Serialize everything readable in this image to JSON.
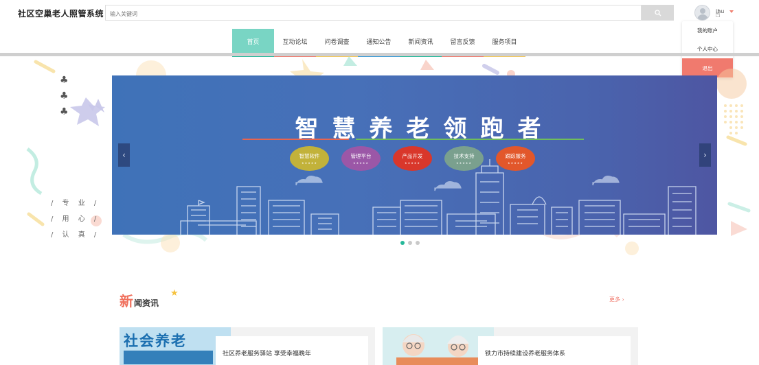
{
  "header": {
    "site_title": "社区空巢老人照管系统",
    "search_placeholder": "输入关键词",
    "search_icon": "search-icon",
    "username": "ihu",
    "avatar_icon": "user-avatar-icon"
  },
  "user_menu": {
    "items": [
      {
        "label": "我的账户"
      },
      {
        "label": "个人中心"
      },
      {
        "label": "退出"
      }
    ],
    "logout_color": "#f07a6e"
  },
  "nav": {
    "items": [
      {
        "label": "首页",
        "color": "#22b99a"
      },
      {
        "label": "互动论坛",
        "color": "#f07a6e"
      },
      {
        "label": "问卷调查",
        "color": "#f3c85a"
      },
      {
        "label": "通知公告",
        "color": "#3a9ad6"
      },
      {
        "label": "新闻资讯",
        "color": "#22b99a"
      },
      {
        "label": "留言反馈",
        "color": "#f07a6e"
      },
      {
        "label": "服务项目",
        "color": "#f3c85a"
      }
    ],
    "active_index": 0,
    "active_color": "#79d5c4"
  },
  "side": {
    "club_icons": [
      "club-icon",
      "club-icon",
      "club-icon"
    ],
    "slogans": [
      "/ 专 业 /",
      "/ 用 心 /",
      "/ 认 真 /"
    ]
  },
  "banner": {
    "title": "智慧养老领跑者",
    "pills": [
      {
        "label": "智慧软件",
        "color": "#c2b23a"
      },
      {
        "label": "管理平台",
        "color": "#9b57a7"
      },
      {
        "label": "产品开发",
        "color": "#d9372b"
      },
      {
        "label": "技术支持",
        "color": "#7aa08e"
      },
      {
        "label": "跟踪服务",
        "color": "#e2572b"
      }
    ],
    "pill_stars": "★★★★★",
    "prev_icon": "chevron-left-icon",
    "next_icon": "chevron-right-icon",
    "slide_count": 3,
    "active_slide": 0
  },
  "news": {
    "title_first": "新",
    "title_rest": "闻资讯",
    "more_label": "更多 ›",
    "items": [
      {
        "title": "社区养老服务驿站 享受幸福晚年",
        "thumb_text": "社会养老"
      },
      {
        "title": "铁力市持续建设养老服务体系"
      }
    ]
  }
}
